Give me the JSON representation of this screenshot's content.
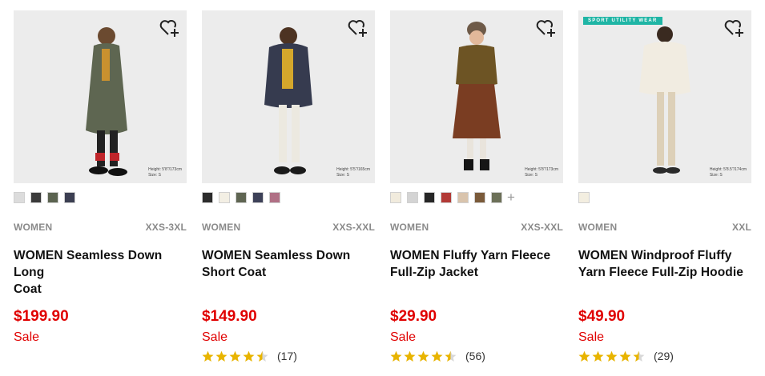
{
  "products": [
    {
      "gender": "WOMEN",
      "size_range": "XXS-3XL",
      "name_line1": "WOMEN Seamless Down Long",
      "name_line2": "Coat",
      "price": "$199.90",
      "sale_label": "Sale",
      "rating": null,
      "review_count": "",
      "fit_height": "Height: 5'8\"/173cm",
      "fit_size": "Size: S",
      "tag": "",
      "swatches": [
        "#dcdcdc",
        "#3a3a3a",
        "#5b6350",
        "#3c3f52"
      ],
      "more_colors": ""
    },
    {
      "gender": "WOMEN",
      "size_range": "XXS-XXL",
      "name_line1": "WOMEN Seamless Down",
      "name_line2": "Short Coat",
      "price": "$149.90",
      "sale_label": "Sale",
      "rating": 4.5,
      "review_count": "(17)",
      "fit_height": "Height: 5'5\"/165cm",
      "fit_size": "Size: S",
      "tag": "",
      "swatches": [
        "#2c2c2c",
        "#f3efe4",
        "#5f6552",
        "#3d4158",
        "#b07085"
      ],
      "more_colors": ""
    },
    {
      "gender": "WOMEN",
      "size_range": "XXS-XXL",
      "name_line1": "WOMEN Fluffy Yarn Fleece",
      "name_line2": "Full-Zip Jacket",
      "price": "$29.90",
      "sale_label": "Sale",
      "rating": 4.5,
      "review_count": "(56)",
      "fit_height": "Height: 5'8\"/173cm",
      "fit_size": "Size: S",
      "tag": "",
      "swatches": [
        "#f1ebdd",
        "#d4d4d4",
        "#262626",
        "#b23a36",
        "#d9c4ad",
        "#7a5a3a",
        "#6c7058"
      ],
      "more_colors": "+"
    },
    {
      "gender": "WOMEN",
      "size_range": "XXL",
      "name_line1": "WOMEN Windproof Fluffy",
      "name_line2": "Yarn Fleece Full-Zip Hoodie",
      "price": "$49.90",
      "sale_label": "Sale",
      "rating": 4.5,
      "review_count": "(29)",
      "fit_height": "Height: 5'8.5\"/174cm",
      "fit_size": "Size: S",
      "tag": "SPORT UTILITY WEAR",
      "swatches": [
        "#f3eee0"
      ],
      "more_colors": ""
    }
  ],
  "colors": {
    "accent": "#e00000",
    "star": "#e8b400"
  },
  "icons": {
    "wishlist": "heart-plus-icon",
    "star": "star-icon"
  }
}
